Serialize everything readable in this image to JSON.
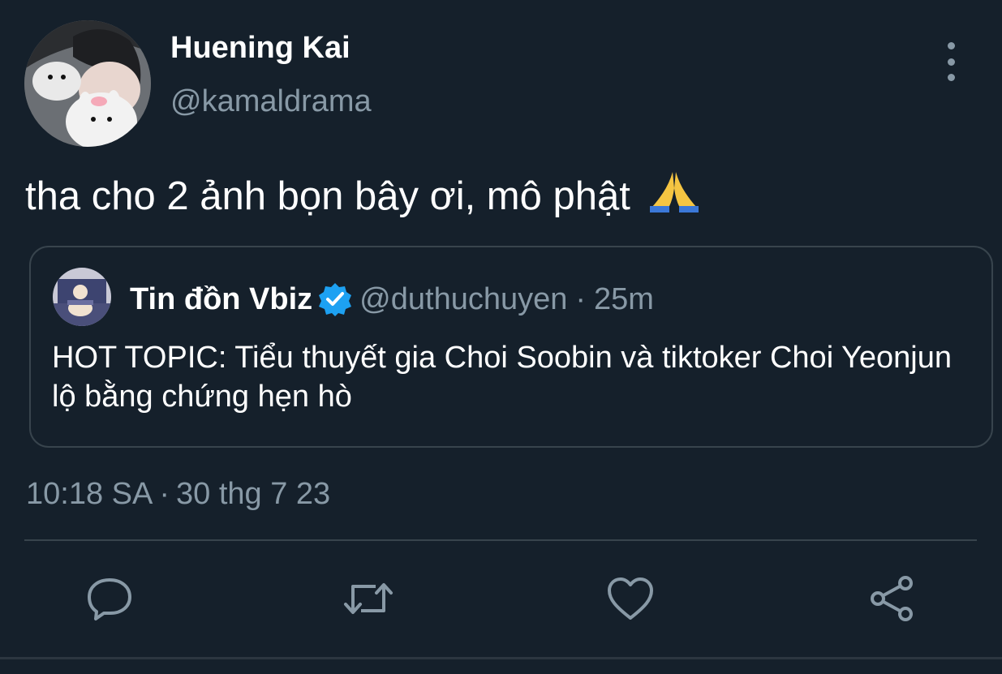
{
  "author": {
    "display_name": "Huening Kai",
    "handle": "@kamaldrama"
  },
  "tweet": {
    "text": "tha cho 2 ảnh bọn bây ơi, mô phật",
    "emoji": "folded-hands"
  },
  "quoted_tweet": {
    "display_name": "Tin đồn Vbiz",
    "verified": true,
    "handle": "@duthuchuyen",
    "separator": "·",
    "time": "25m",
    "text": "HOT TOPIC: Tiểu thuyết gia Choi Soobin và tiktoker Choi Yeonjun lộ bằng chứng hẹn hò"
  },
  "timestamp": {
    "time": "10:18 SA",
    "separator": "·",
    "date": "30 thg 7 23"
  },
  "actions": [
    "reply-icon",
    "retweet-icon",
    "like-icon",
    "share-icon"
  ],
  "colors": {
    "background": "#15202b",
    "secondary_text": "#8899a6",
    "border": "#38444d",
    "verified": "#1da1f2"
  }
}
